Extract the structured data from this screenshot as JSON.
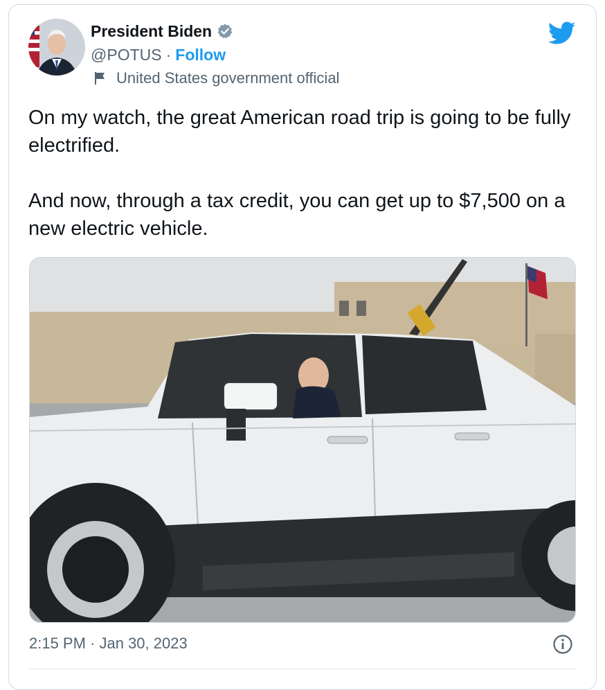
{
  "tweet": {
    "author": {
      "name": "President Biden",
      "handle": "@POTUS",
      "separator": "·",
      "follow_label": "Follow",
      "account_label": "United States government official",
      "verified_icon": "verified-badge-icon",
      "label_icon": "flag-icon"
    },
    "platform_icon": "twitter-bird-icon",
    "text": "On my watch, the great American road trip is going to be fully electrified.\n\nAnd now, through a tax credit, you can get up to $7,500 on a new electric vehicle.",
    "timestamp": "2:15 PM · Jan 30, 2023",
    "info_icon": "info-icon"
  },
  "colors": {
    "accent": "#1d9bf0",
    "text_primary": "#0f1419",
    "text_secondary": "#536471",
    "verified_badge": "#829aab"
  }
}
